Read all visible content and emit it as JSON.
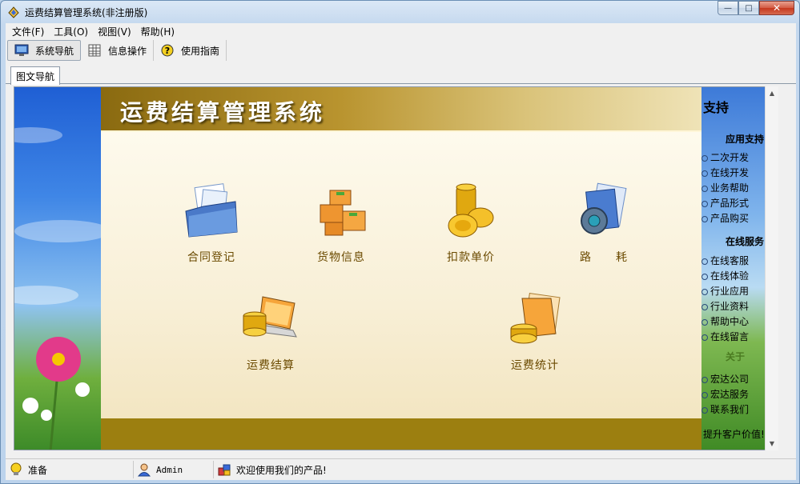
{
  "window": {
    "title": "运费结算管理系统(非注册版)",
    "controls": {
      "minimize": "—",
      "maximize": "□",
      "close": "✕"
    }
  },
  "menu": [
    {
      "label": "文件(F)"
    },
    {
      "label": "工具(O)"
    },
    {
      "label": "视图(V)"
    },
    {
      "label": "帮助(H)"
    }
  ],
  "toolbar": [
    {
      "label": "系统导航",
      "icon": "monitor-icon",
      "active": true
    },
    {
      "label": "信息操作",
      "icon": "grid-icon",
      "active": false
    },
    {
      "label": "使用指南",
      "icon": "help-icon",
      "active": false
    }
  ],
  "tab": {
    "label": "图文导航"
  },
  "panel": {
    "title": "运费结算管理系统",
    "nav_items": [
      {
        "label": "合同登记",
        "icon": "folder-documents-icon"
      },
      {
        "label": "货物信息",
        "icon": "boxes-icon"
      },
      {
        "label": "扣款单价",
        "icon": "coins-icon"
      },
      {
        "label": "路　　耗",
        "icon": "gear-document-icon"
      },
      {
        "label": "运费结算",
        "icon": "laptop-coins-icon"
      },
      {
        "label": "运费统计",
        "icon": "folder-coins-icon"
      }
    ]
  },
  "support": {
    "title": "支持",
    "section1": "应用支持",
    "links1": [
      "二次开发",
      "在线开发",
      "业务帮助",
      "产品形式",
      "产品购买"
    ],
    "section2": "在线服务",
    "links2": [
      "在线客服",
      "在线体验",
      "行业应用",
      "行业资料",
      "帮助中心",
      "在线留言"
    ],
    "section3": "关于",
    "links3": [
      "宏达公司",
      "宏达服务",
      "联系我们"
    ],
    "footer": "提升客户价值!"
  },
  "status": {
    "state": "准备",
    "user": "Admin",
    "message": "欢迎使用我们的产品!"
  },
  "colors": {
    "panel_header": "#b9942f",
    "panel_footer": "#9c7f10",
    "nav_label": "#6b4a00"
  }
}
